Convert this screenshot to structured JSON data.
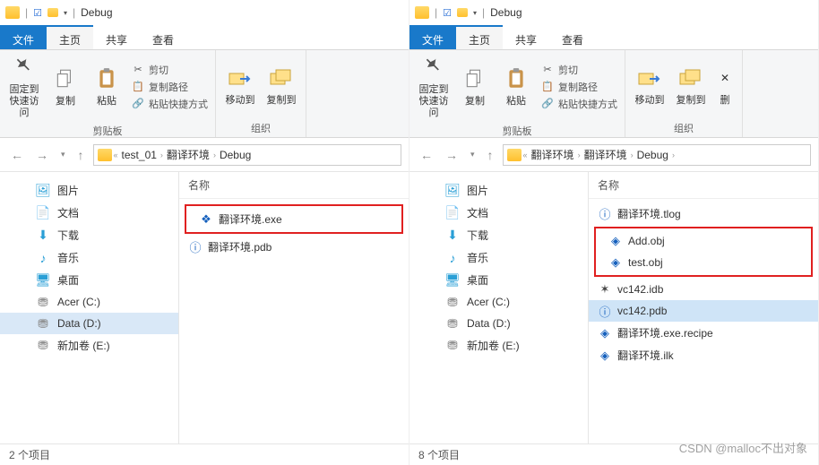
{
  "title": "Debug",
  "tabs": {
    "file": "文件",
    "home": "主页",
    "share": "共享",
    "view": "查看"
  },
  "ribbon": {
    "pin": "固定到\n快速访问",
    "copy": "复制",
    "paste": "粘贴",
    "cut": "剪切",
    "copypath": "复制路径",
    "pasteshortcut": "粘贴快捷方式",
    "moveto": "移动到",
    "copyto": "复制到",
    "delete": "删",
    "clipboard_group": "剪贴板",
    "organize_group": "组织"
  },
  "left": {
    "breadcrumbs": [
      "test_01",
      "翻译环境",
      "Debug"
    ],
    "column_name": "名称",
    "files": [
      {
        "name": "翻译环境.exe",
        "highlight": true,
        "selected": false,
        "icon": "app"
      },
      {
        "name": "翻译环境.pdb",
        "highlight": false,
        "selected": false,
        "icon": "pdb"
      }
    ],
    "status": "2 个项目"
  },
  "right": {
    "breadcrumbs": [
      "翻译环境",
      "翻译环境",
      "Debug"
    ],
    "column_name": "名称",
    "files": [
      {
        "name": "翻译环境.tlog",
        "highlight": false,
        "selected": false,
        "icon": "log"
      },
      {
        "name": "Add.obj",
        "highlight": true,
        "selected": false,
        "icon": "obj"
      },
      {
        "name": "test.obj",
        "highlight": true,
        "selected": false,
        "icon": "obj"
      },
      {
        "name": "vc142.idb",
        "highlight": false,
        "selected": false,
        "icon": "idb"
      },
      {
        "name": "vc142.pdb",
        "highlight": false,
        "selected": true,
        "icon": "pdb"
      },
      {
        "name": "翻译环境.exe.recipe",
        "highlight": false,
        "selected": false,
        "icon": "recipe"
      },
      {
        "name": "翻译环境.ilk",
        "highlight": false,
        "selected": false,
        "icon": "ilk"
      }
    ],
    "status": "8 个项目"
  },
  "sidebar": [
    {
      "label": "图片",
      "icon": "pictures"
    },
    {
      "label": "文档",
      "icon": "docs"
    },
    {
      "label": "下载",
      "icon": "downloads"
    },
    {
      "label": "音乐",
      "icon": "music"
    },
    {
      "label": "桌面",
      "icon": "desktop"
    },
    {
      "label": "Acer (C:)",
      "icon": "drive"
    },
    {
      "label": "Data (D:)",
      "icon": "drive",
      "selected_left": true
    },
    {
      "label": "新加卷 (E:)",
      "icon": "drive"
    }
  ],
  "watermark": "CSDN @malloc不出对象"
}
